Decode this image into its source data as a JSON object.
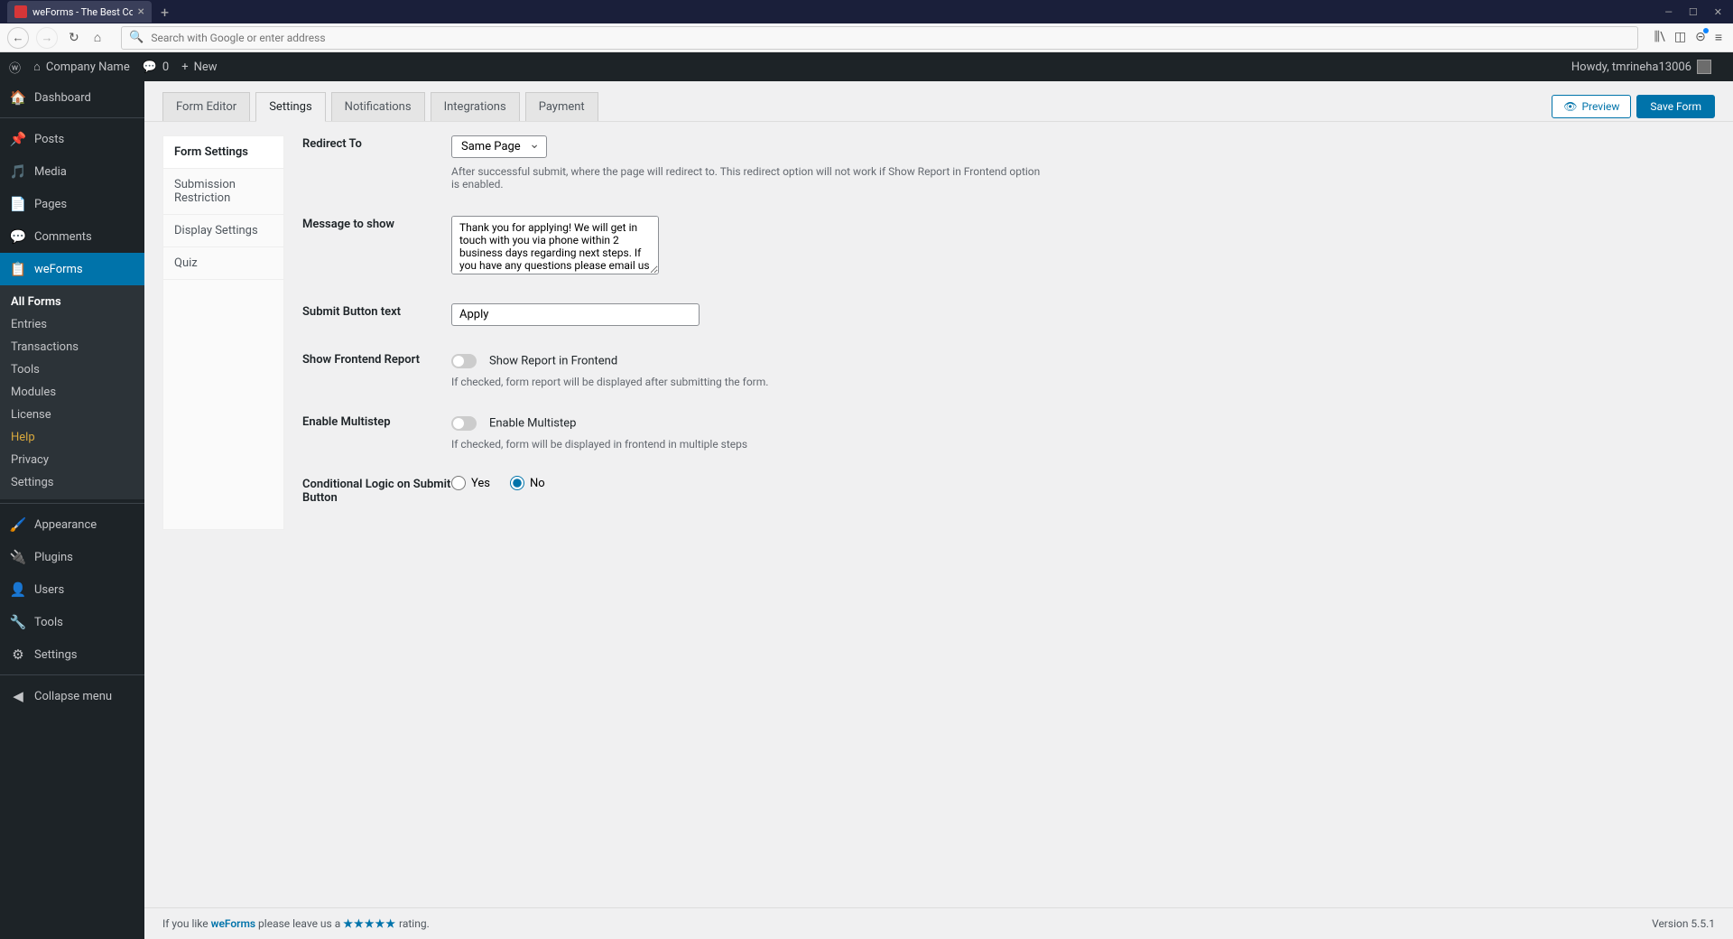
{
  "browser": {
    "tab_title": "weForms - The Best Contact Fo",
    "url_placeholder": "Search with Google or enter address"
  },
  "admin_bar": {
    "site_name": "Company Name",
    "comments": "0",
    "new": "New",
    "howdy": "Howdy, tmrineha13006"
  },
  "sidebar": {
    "dashboard": "Dashboard",
    "posts": "Posts",
    "media": "Media",
    "pages": "Pages",
    "comments": "Comments",
    "weforms": "weForms",
    "submenu": {
      "all_forms": "All Forms",
      "entries": "Entries",
      "transactions": "Transactions",
      "tools": "Tools",
      "modules": "Modules",
      "license": "License",
      "help": "Help",
      "privacy": "Privacy",
      "settings": "Settings"
    },
    "appearance": "Appearance",
    "plugins": "Plugins",
    "users": "Users",
    "tools": "Tools",
    "settings": "Settings",
    "collapse": "Collapse menu"
  },
  "tabs": {
    "form_editor": "Form Editor",
    "settings": "Settings",
    "notifications": "Notifications",
    "integrations": "Integrations",
    "payment": "Payment"
  },
  "actions": {
    "preview": "Preview",
    "save": "Save Form"
  },
  "settings_nav": {
    "form_settings": "Form Settings",
    "submission_restriction": "Submission Restriction",
    "display_settings": "Display Settings",
    "quiz": "Quiz"
  },
  "form": {
    "redirect_to": {
      "label": "Redirect To",
      "value": "Same Page",
      "help": "After successful submit, where the page will redirect to. This redirect option will not work if Show Report in Frontend option is enabled."
    },
    "message": {
      "label": "Message to show",
      "value": "Thank you for applying! We will get in touch with you via phone within 2 business days regarding next steps. If you have any questions please email us at"
    },
    "submit_btn": {
      "label": "Submit Button text",
      "value": "Apply"
    },
    "frontend_report": {
      "label": "Show Frontend Report",
      "toggle_label": "Show Report in Frontend",
      "help": "If checked, form report will be displayed after submitting the form."
    },
    "multistep": {
      "label": "Enable Multistep",
      "toggle_label": "Enable Multistep",
      "help": "If checked, form will be displayed in frontend in multiple steps"
    },
    "conditional": {
      "label": "Conditional Logic on Submit Button",
      "yes": "Yes",
      "no": "No"
    }
  },
  "footer": {
    "prefix": "If you like ",
    "link": "weForms",
    "mid": " please leave us a ",
    "stars": "★★★★★",
    "suffix": " rating.",
    "version": "Version 5.5.1"
  }
}
